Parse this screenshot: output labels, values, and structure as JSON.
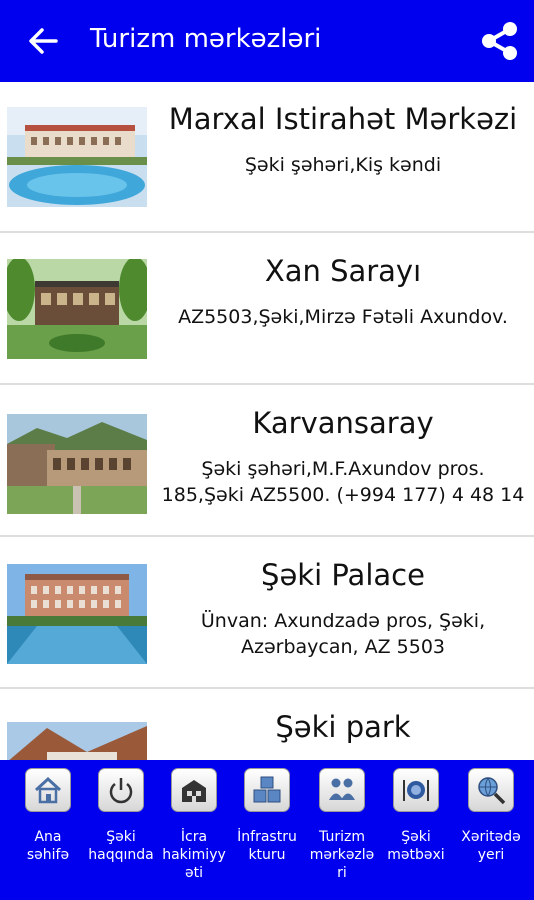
{
  "appbar": {
    "title": "Turizm mərkəzləri",
    "back_icon": "arrow-back-icon",
    "share_icon": "share-icon",
    "color": "#0000ee"
  },
  "items": [
    {
      "title": "Marxal Istirahət Mərkəzi",
      "address": "Şəki şəhəri,Kiş kəndi"
    },
    {
      "title": "Xan Sarayı",
      "address": "AZ5503,Şəki,Mirzə Fətəli Axundov."
    },
    {
      "title": "Karvansaray",
      "address": "Şəki şəhəri,M.F.Axundov pros.\n185,Şəki AZ5500. (+994 177) 4 48 14"
    },
    {
      "title": "Şəki Palace",
      "address": "Ünvan:   Axundzadə pros, Şəki,\nAzərbaycan, AZ 5503"
    },
    {
      "title": "Şəki park",
      "address": ""
    }
  ],
  "bottom_nav": [
    {
      "label": "Ana\nsəhifə",
      "icon": "home-icon"
    },
    {
      "label": "Şəki\nhaqqında",
      "icon": "power-icon"
    },
    {
      "label": "İcra\nhakimiyy\nəti",
      "icon": "building-icon"
    },
    {
      "label": "İnfrastru\nkturu",
      "icon": "blocks-icon"
    },
    {
      "label": "Turizm\nmərkəzlə\nri",
      "icon": "people-icon"
    },
    {
      "label": "Şəki\nmətbəxi",
      "icon": "dining-icon"
    },
    {
      "label": "Xəritədə\nyeri",
      "icon": "globe-search-icon"
    }
  ]
}
